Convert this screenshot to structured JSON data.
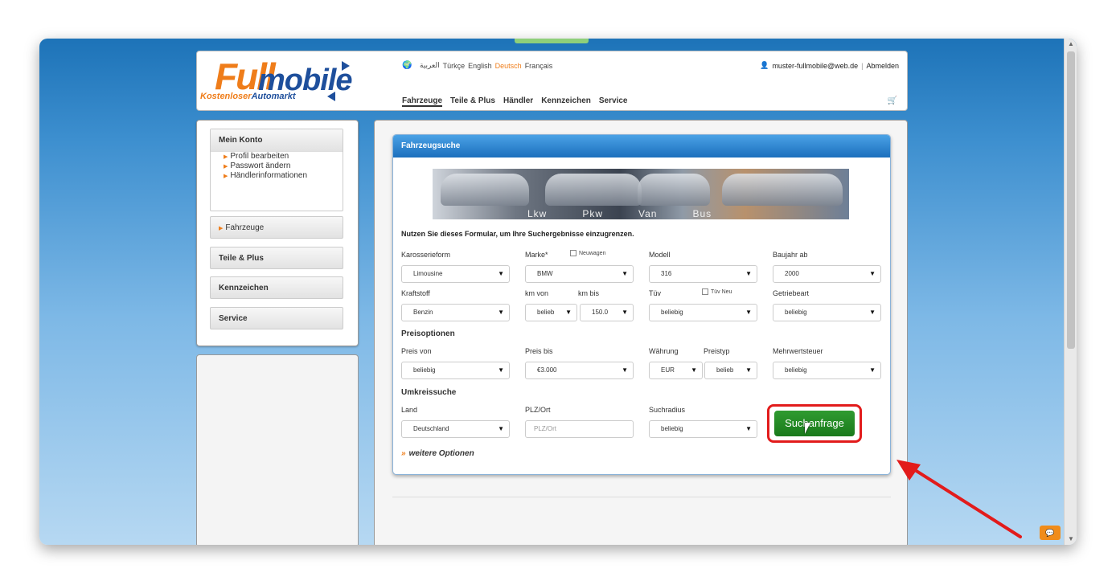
{
  "languages": [
    "العربية",
    "Türkçe",
    "English",
    "Deutsch",
    "Français"
  ],
  "active_language": "Deutsch",
  "user": {
    "email": "muster-fullmobile@web.de",
    "separator": "|",
    "logout": "Abmelden"
  },
  "logo": {
    "full": "Full",
    "mobile": "mobile",
    "sub_a": "Kostenloser",
    "sub_b": "Automarkt"
  },
  "nav": [
    "Fahrzeuge",
    "Teile & Plus",
    "Händler",
    "Kennzeichen",
    "Service"
  ],
  "sidebar": {
    "konto_title": "Mein Konto",
    "konto_links": [
      "Profil bearbeiten",
      "Passwort ändern",
      "Händlerinformationen"
    ],
    "sections": [
      "Fahrzeuge",
      "Teile & Plus",
      "Kennzeichen",
      "Service"
    ]
  },
  "panel": {
    "title": "Fahrzeugsuche",
    "banner_labels": [
      "Lkw",
      "Pkw",
      "Van",
      "Bus"
    ],
    "intro": "Nutzen Sie dieses Formular, um Ihre Suchergebnisse einzugrenzen.",
    "labels": {
      "karosserieform": "Karosserieform",
      "marke": "Marke*",
      "neuwagen": "Neuwagen",
      "modell": "Modell",
      "baujahr": "Baujahr ab",
      "kraftstoff": "Kraftstoff",
      "km_von": "km von",
      "km_bis": "km bis",
      "tuev": "Tüv",
      "tuev_neu": "Tüv Neu",
      "getriebe": "Getriebeart",
      "preisoptionen": "Preisoptionen",
      "preis_von": "Preis von",
      "preis_bis": "Preis bis",
      "waehrung": "Währung",
      "preistyp": "Preistyp",
      "mwst": "Mehrwertsteuer",
      "umkreissuche": "Umkreissuche",
      "land": "Land",
      "plz": "PLZ/Ort",
      "suchradius": "Suchradius"
    },
    "values": {
      "karosserieform": "Limousine",
      "marke": "BMW",
      "modell": "316",
      "baujahr": "2000",
      "kraftstoff": "Benzin",
      "km_von": "belieb",
      "km_bis": "150.0",
      "tuev": "beliebig",
      "getriebe": "beliebig",
      "preis_von": "beliebig",
      "preis_bis": "€3.000",
      "waehrung": "EUR",
      "preistyp": "belieb",
      "mwst": "beliebig",
      "land": "Deutschland",
      "plz_placeholder": "PLZ/Ort",
      "suchradius": "beliebig"
    },
    "submit": "Suchanfrage",
    "more": "weitere Optionen"
  },
  "colors": {
    "accent": "#ef7d1a",
    "brand_blue": "#1e4f9c",
    "submit_green": "#1f861f",
    "highlight_red": "#e21b1b"
  }
}
